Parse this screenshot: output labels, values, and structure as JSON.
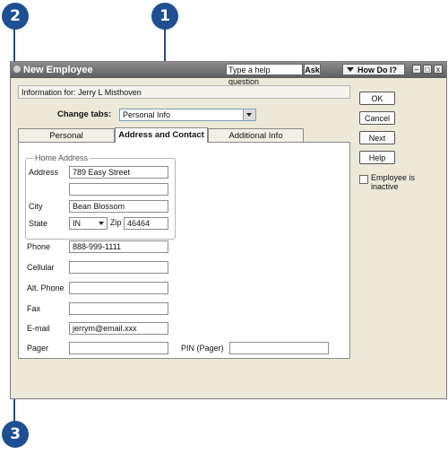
{
  "callouts": [
    "2",
    "1",
    "3"
  ],
  "window": {
    "title": "New Employee",
    "help_question": "Type a help question",
    "ask": "Ask",
    "how_do_i": "How Do I?",
    "controls": [
      "–",
      "□",
      "x"
    ]
  },
  "info": "Information for: Jerry L Misthoven",
  "change_tabs": {
    "label": "Change tabs:",
    "value": "Personal Info"
  },
  "tabs": [
    "Personal",
    "Address and Contact",
    "Additional Info"
  ],
  "active_tab": 1,
  "home_address": {
    "legend": "Home Address",
    "address_label": "Address",
    "address_line1": "789 Easy Street",
    "address_line2": "",
    "city_label": "City",
    "city": "Bean Blossom",
    "state_label": "State",
    "state": "IN",
    "zip_label": "Zip",
    "zip": "46464"
  },
  "contact": {
    "phone_label": "Phone",
    "phone": "888-999-1111",
    "cellular_label": "Cellular",
    "cellular": "",
    "alt_phone_label": "Alt. Phone",
    "alt_phone": "",
    "fax_label": "Fax",
    "fax": "",
    "email_label": "E-mail",
    "email": "jerrym@email.xxx",
    "pager_label": "Pager",
    "pager": "",
    "pin_label": "PIN (Pager)",
    "pin": ""
  },
  "buttons": {
    "ok": "OK",
    "cancel": "Cancel",
    "next": "Next",
    "help": "Help"
  },
  "inactive_label": "Employee is inactive",
  "colors": {
    "callout": "#1d4f93",
    "titlebar": "#6e6e6e",
    "window_bg": "#ece9d8"
  }
}
